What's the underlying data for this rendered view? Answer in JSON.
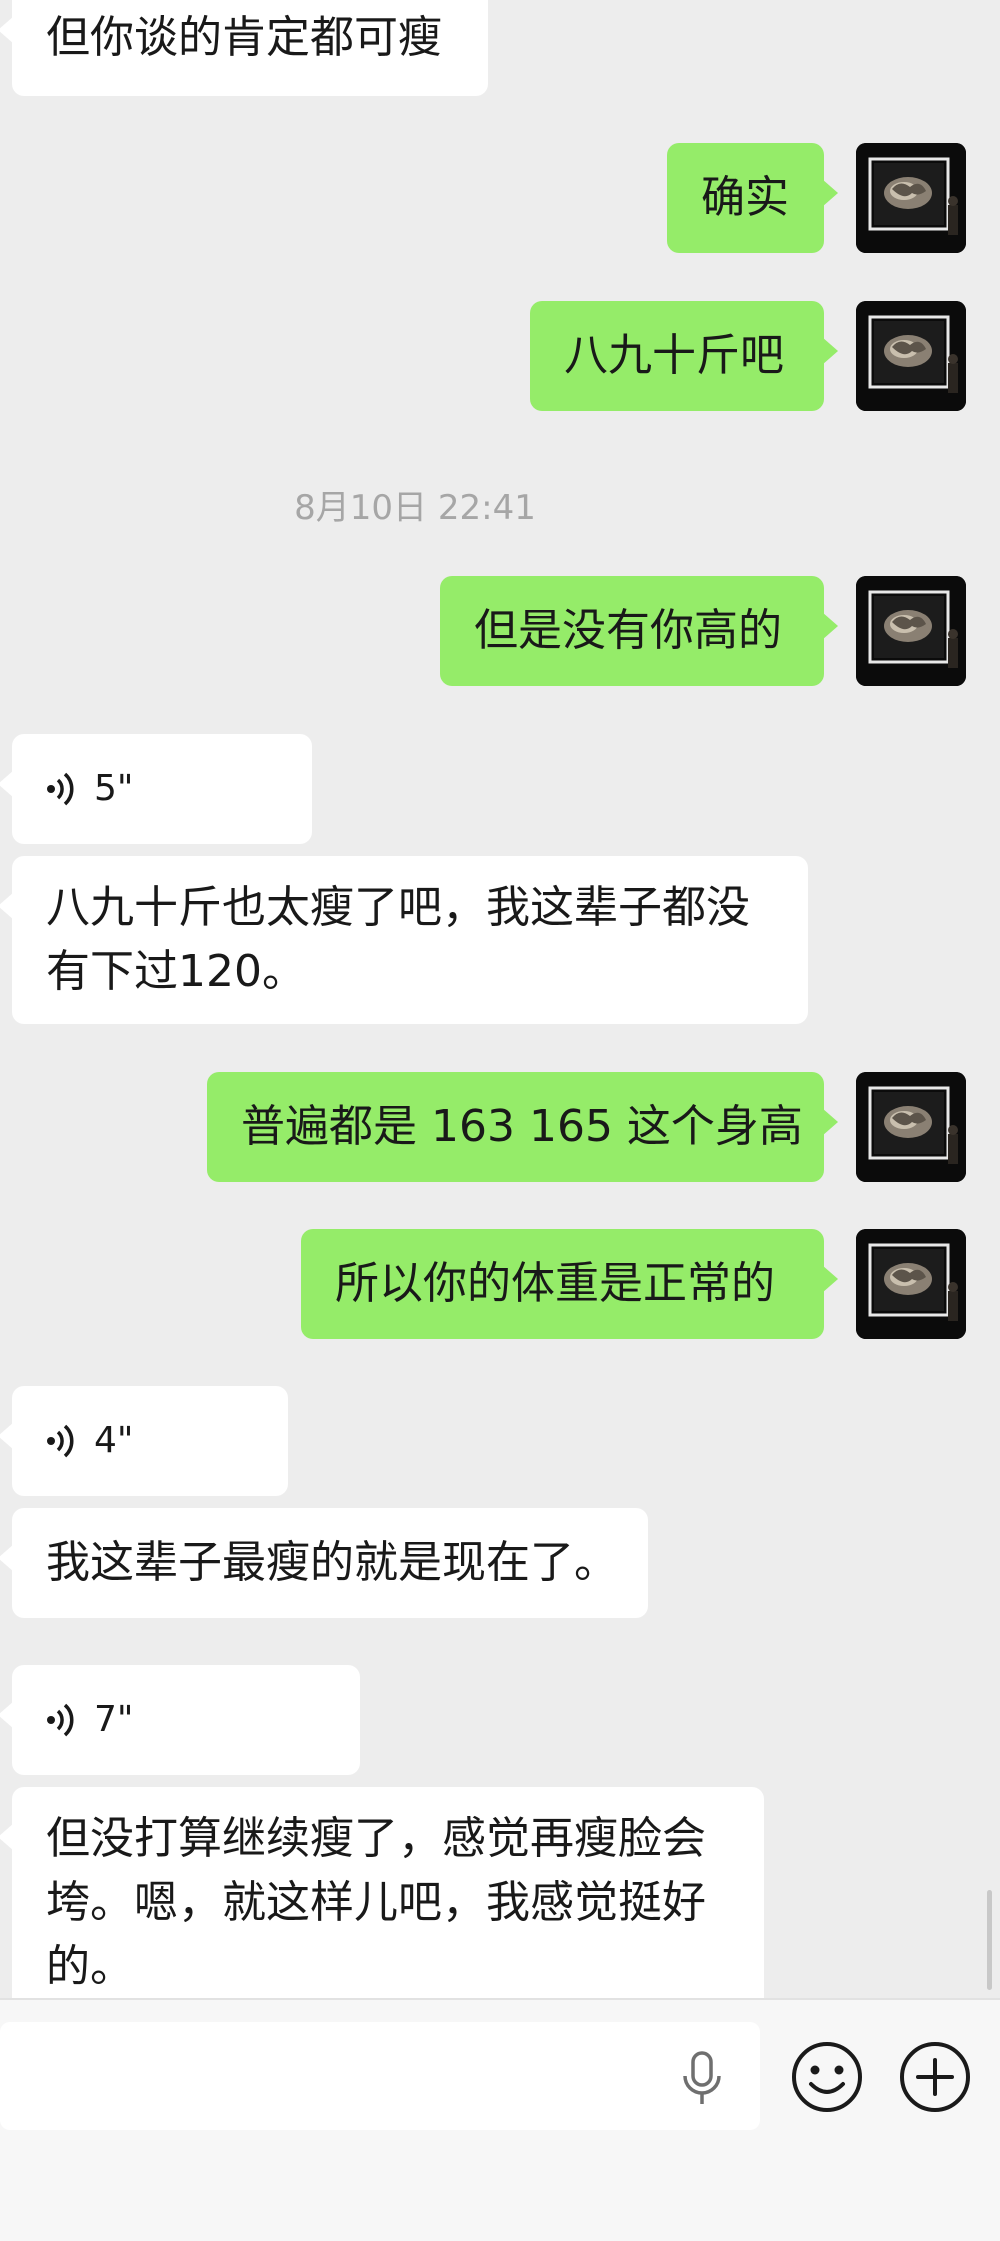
{
  "messages": {
    "m1": "但你谈的肯定都可瘦",
    "m2": "确实",
    "m3": "八九十斤吧",
    "timestamp": "8月10日 22:41",
    "m4": "但是没有你高的",
    "voice1": "5\"",
    "m5_line1": "八九十斤也太瘦了吧，我这辈子都没",
    "m5_line2": "有下过120。",
    "m6": "普遍都是 163 165 这个身高",
    "m7": "所以你的体重是正常的",
    "voice2": "4\"",
    "m8": "我这辈子最瘦的就是现在了。",
    "voice3": "7\"",
    "m9_line1": "但没打算继续瘦了，感觉再瘦脸会",
    "m9_line2": "垮。嗯，就这样儿吧，我感觉挺好",
    "m9_line3": "的。"
  },
  "composer": {
    "input_value": "",
    "icons": [
      "microphone-icon",
      "emoji-icon",
      "plus-icon"
    ]
  },
  "colors": {
    "background": "#ededed",
    "incoming_bubble": "#ffffff",
    "outgoing_bubble": "#95ec69",
    "text": "#191919",
    "timestamp": "#a6a6a6"
  }
}
